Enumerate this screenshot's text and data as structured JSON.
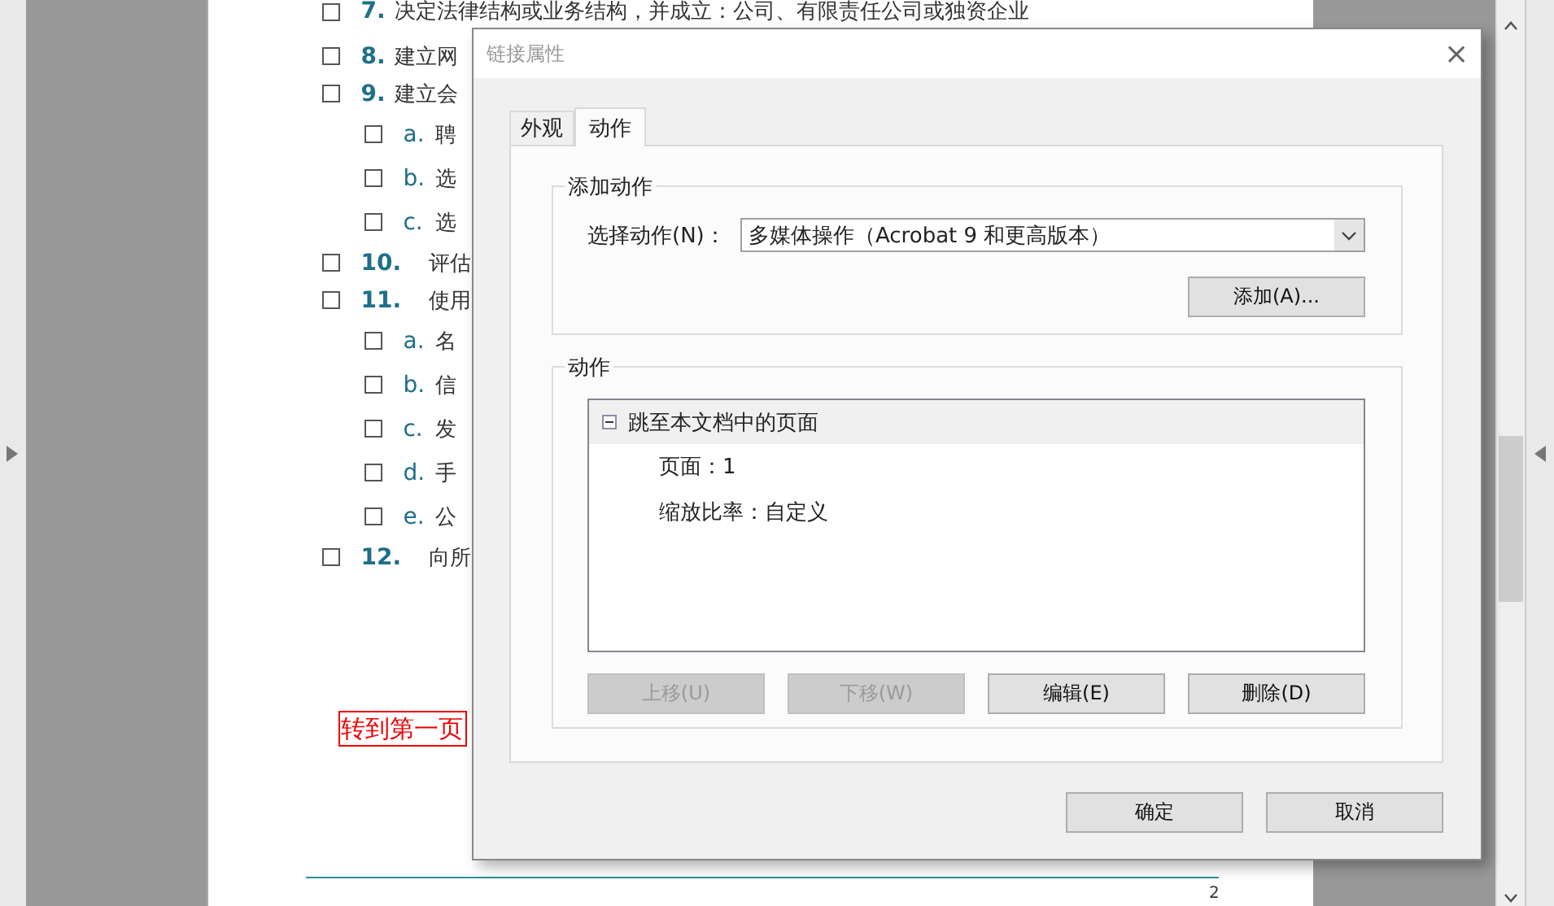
{
  "document": {
    "outline": [
      {
        "number": "7.",
        "text": "决定法律结构或业务结构，并成立：公司、有限责任公司或独资企业",
        "checked": false
      },
      {
        "number": "8.",
        "text": "建立网",
        "checked": false
      },
      {
        "number": "9.",
        "text": "建立会",
        "checked": false,
        "children": [
          {
            "number": "a.",
            "text": "聘",
            "checked": false
          },
          {
            "number": "b.",
            "text": "选",
            "checked": false
          },
          {
            "number": "c.",
            "text": "选",
            "checked": false
          }
        ]
      },
      {
        "number": "10.",
        "text": "评估",
        "checked": false
      },
      {
        "number": "11.",
        "text": "使用",
        "checked": false,
        "children": [
          {
            "number": "a.",
            "text": "名",
            "checked": false
          },
          {
            "number": "b.",
            "text": "信",
            "checked": false
          },
          {
            "number": "c.",
            "text": "发",
            "checked": false
          },
          {
            "number": "d.",
            "text": "手",
            "checked": false
          },
          {
            "number": "e.",
            "text": "公",
            "checked": false
          }
        ]
      },
      {
        "number": "12.",
        "text": "向所",
        "checked": false
      }
    ],
    "link": "转到第一页",
    "page_number": "2"
  },
  "dialog": {
    "title": "链接属性",
    "close": "×",
    "tabs": [
      {
        "label": "外观",
        "selected": false
      },
      {
        "label": "动作",
        "selected": true
      }
    ],
    "add_action": {
      "legend": "添加动作",
      "label": "选择动作(N)：",
      "value": "多媒体操作（Acrobat 9 和更高版本）",
      "button": "添加(A)..."
    },
    "actions": {
      "legend": "动作",
      "tree": [
        {
          "label": "跳至本文档中的页面",
          "expanded": true,
          "children": [
            "页面：1",
            "缩放比率：自定义"
          ]
        }
      ],
      "buttons": [
        {
          "label": "上移(U)",
          "disabled": true
        },
        {
          "label": "下移(W)",
          "disabled": true
        },
        {
          "label": "编辑(E)",
          "disabled": false
        },
        {
          "label": "删除(D)",
          "disabled": false
        }
      ]
    },
    "footer_buttons": [
      "确定",
      "取消"
    ]
  }
}
